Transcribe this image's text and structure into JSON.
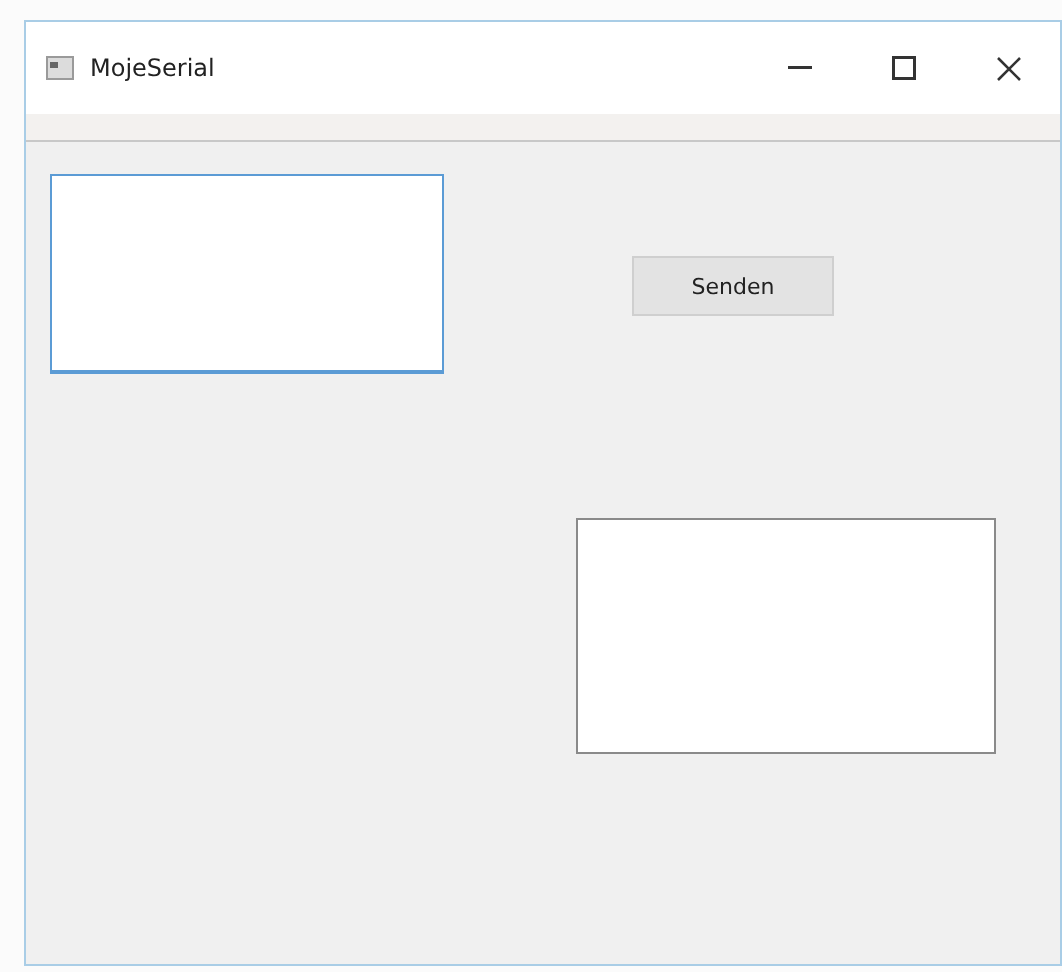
{
  "window": {
    "title": "MojeSerial"
  },
  "input": {
    "focused": true
  },
  "send_button": {
    "label": "Senden"
  },
  "output": {
    "focused": false
  }
}
